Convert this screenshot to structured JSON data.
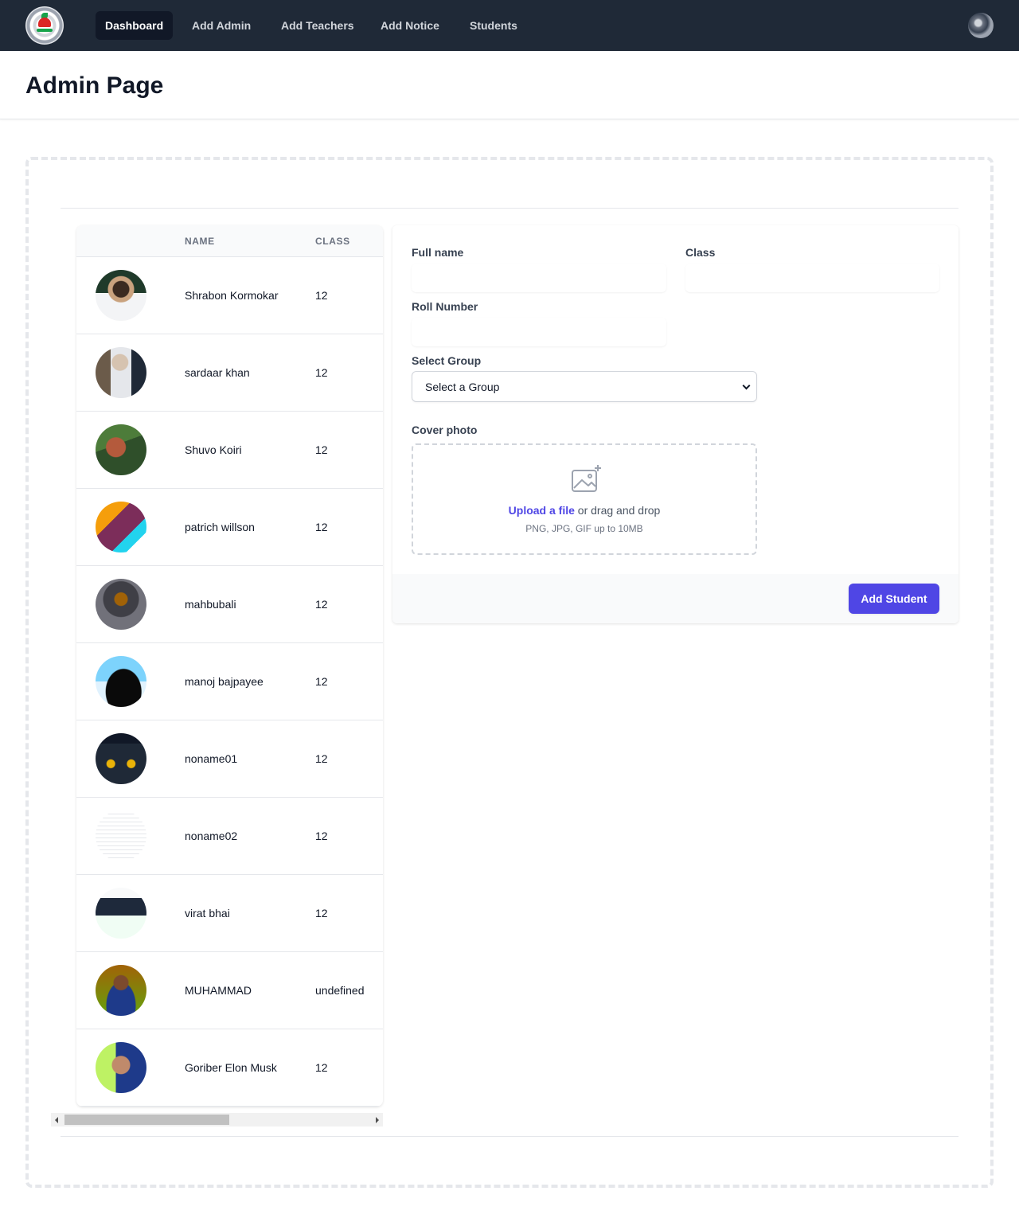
{
  "nav": {
    "links": [
      "Dashboard",
      "Add Admin",
      "Add Teachers",
      "Add Notice",
      "Students"
    ],
    "active": "Dashboard"
  },
  "header": {
    "title": "Admin Page"
  },
  "table": {
    "columns": [
      "NAME",
      "CLASS"
    ],
    "rows": [
      {
        "name": "Shrabon Kormokar",
        "class": "12"
      },
      {
        "name": "sardaar khan",
        "class": "12"
      },
      {
        "name": "Shuvo Koiri",
        "class": "12"
      },
      {
        "name": "patrich willson",
        "class": "12"
      },
      {
        "name": "mahbubali",
        "class": "12"
      },
      {
        "name": "manoj bajpayee",
        "class": "12"
      },
      {
        "name": "noname01",
        "class": "12"
      },
      {
        "name": "noname02",
        "class": "12"
      },
      {
        "name": "virat bhai",
        "class": "12"
      },
      {
        "name": "MUHAMMAD",
        "class": "undefined"
      },
      {
        "name": "Goriber Elon Musk",
        "class": "12"
      }
    ]
  },
  "form": {
    "full_name_label": "Full name",
    "class_label": "Class",
    "roll_label": "Roll Number",
    "group_label": "Select Group",
    "group_selected": "Select a Group",
    "cover_label": "Cover photo",
    "upload_link": "Upload a file",
    "upload_rest": "or drag and drop",
    "upload_hint": "PNG, JPG, GIF up to 10MB",
    "submit_label": "Add Student"
  },
  "colors": {
    "nav_bg": "#1f2937",
    "accent": "#4f46e5"
  }
}
